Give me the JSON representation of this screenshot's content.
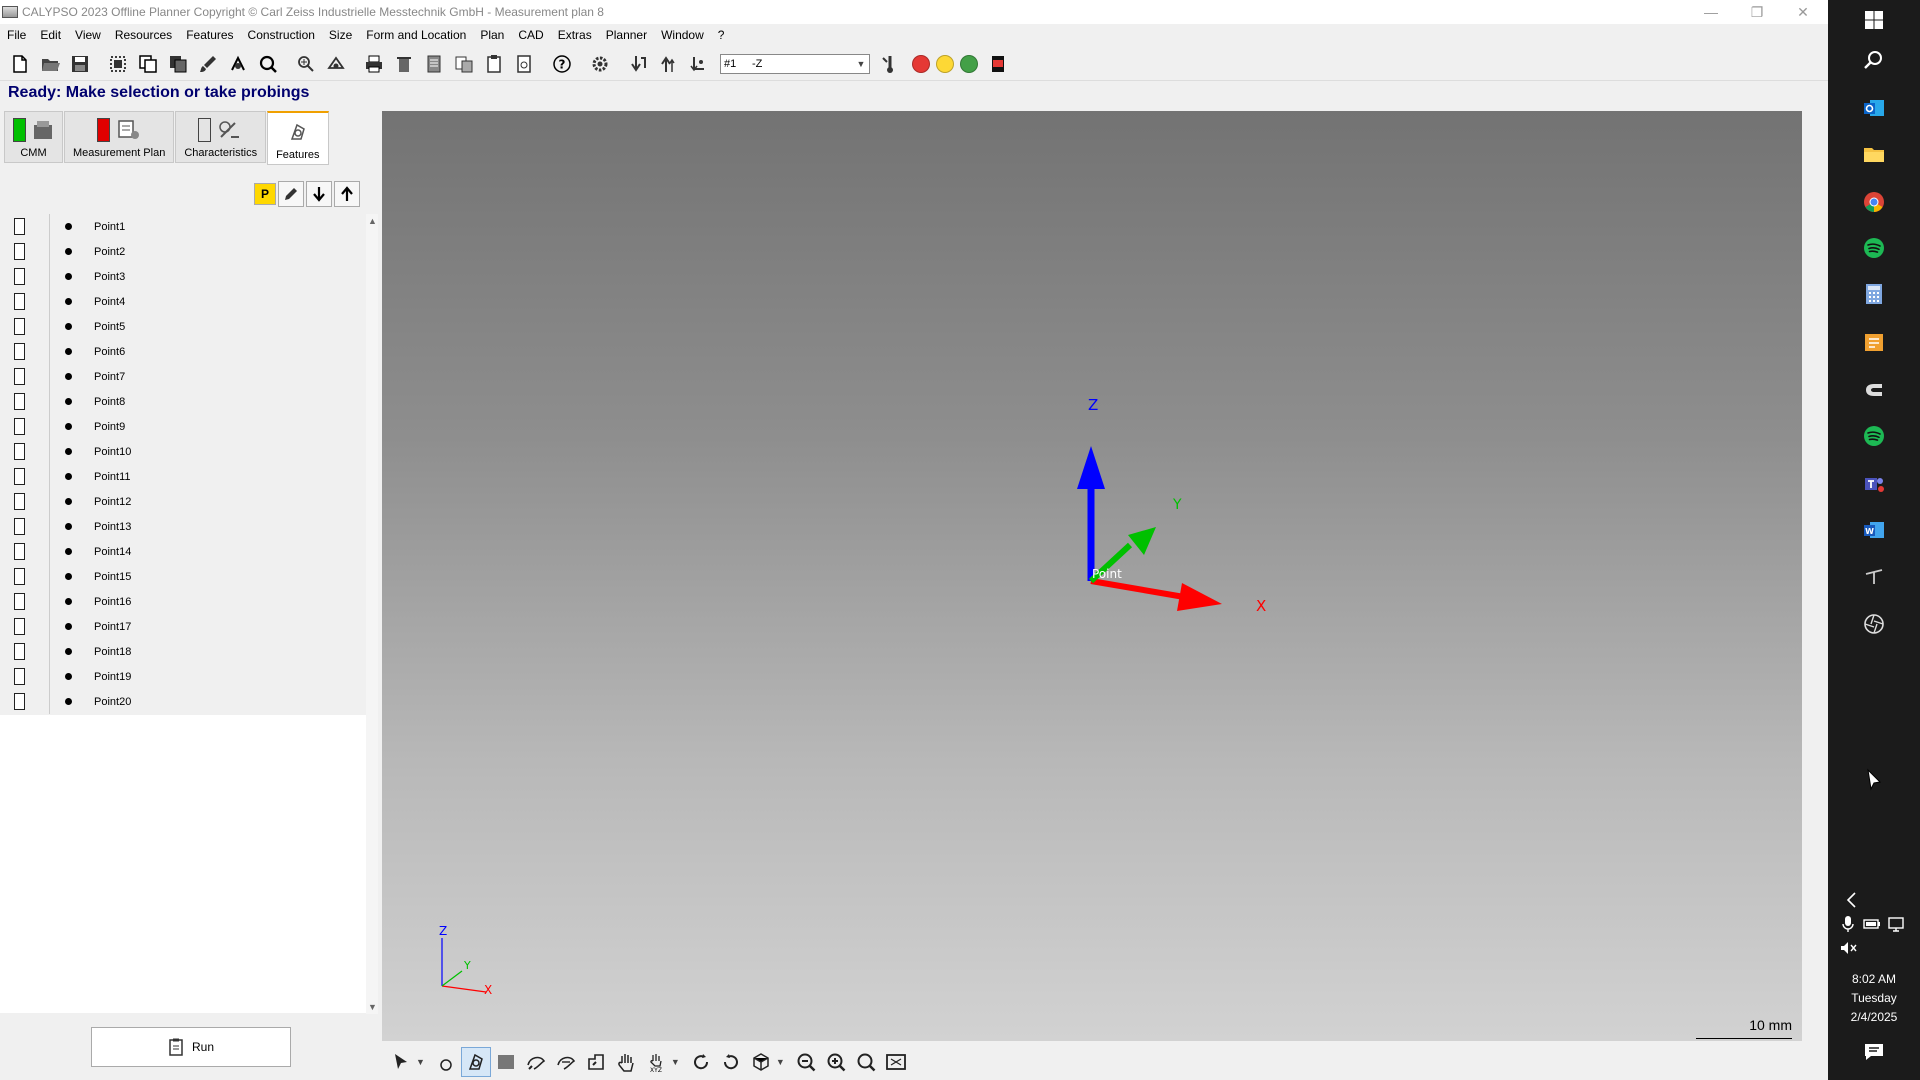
{
  "window": {
    "title": "CALYPSO 2023 Offline Planner Copyright © Carl Zeiss Industrielle Messtechnik GmbH - Measurement plan 8",
    "min": "—",
    "restore": "❐",
    "close": "✕"
  },
  "menu": [
    "File",
    "Edit",
    "View",
    "Resources",
    "Features",
    "Construction",
    "Size",
    "Form and Location",
    "Plan",
    "CAD",
    "Extras",
    "Planner",
    "Window",
    "?"
  ],
  "toolbar": {
    "probe_position": "#1",
    "probe_direction": "-Z",
    "status_dots": [
      "#e53935",
      "#fdd835",
      "#43a047"
    ]
  },
  "status": "Ready: Make selection or take probings",
  "tabs": [
    {
      "label": "CMM",
      "led": "#00c000"
    },
    {
      "label": "Measurement Plan",
      "led": "#e00000"
    },
    {
      "label": "Characteristics",
      "led": ""
    },
    {
      "label": "Features",
      "led": ""
    }
  ],
  "list_toolbar": {
    "p_label": "P"
  },
  "features": [
    "Point1",
    "Point2",
    "Point3",
    "Point4",
    "Point5",
    "Point6",
    "Point7",
    "Point8",
    "Point9",
    "Point10",
    "Point11",
    "Point12",
    "Point13",
    "Point14",
    "Point15",
    "Point16",
    "Point17",
    "Point18",
    "Point19",
    "Point20"
  ],
  "run_label": "Run",
  "viewport": {
    "axis_x": "X",
    "axis_y": "Y",
    "axis_z": "Z",
    "origin_label": "Point",
    "scale": "10 mm",
    "colors": {
      "x": "#ff0000",
      "y": "#00c000",
      "z": "#0000ff"
    }
  },
  "clock": {
    "time": "8:02 AM",
    "day": "Tuesday",
    "date": "2/4/2025"
  }
}
